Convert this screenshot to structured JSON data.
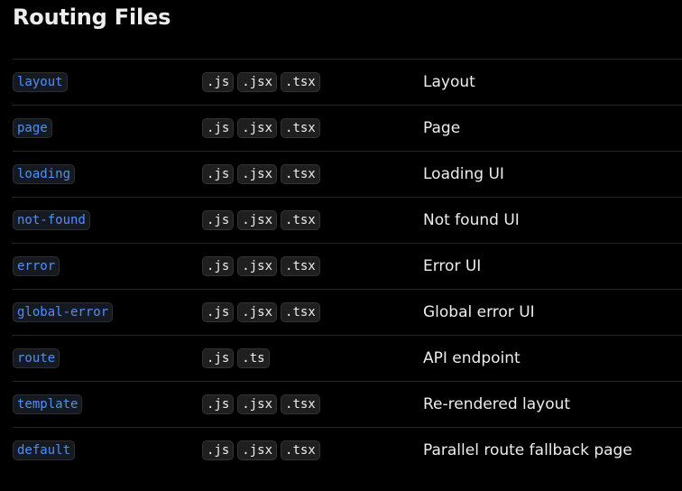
{
  "page": {
    "title": "Routing Files"
  },
  "rows": [
    {
      "file": "layout",
      "exts": [
        ".js",
        ".jsx",
        ".tsx"
      ],
      "desc": "Layout"
    },
    {
      "file": "page",
      "exts": [
        ".js",
        ".jsx",
        ".tsx"
      ],
      "desc": "Page"
    },
    {
      "file": "loading",
      "exts": [
        ".js",
        ".jsx",
        ".tsx"
      ],
      "desc": "Loading UI"
    },
    {
      "file": "not-found",
      "exts": [
        ".js",
        ".jsx",
        ".tsx"
      ],
      "desc": "Not found UI"
    },
    {
      "file": "error",
      "exts": [
        ".js",
        ".jsx",
        ".tsx"
      ],
      "desc": "Error UI"
    },
    {
      "file": "global-error",
      "exts": [
        ".js",
        ".jsx",
        ".tsx"
      ],
      "desc": "Global error UI"
    },
    {
      "file": "route",
      "exts": [
        ".js",
        ".ts"
      ],
      "desc": "API endpoint"
    },
    {
      "file": "template",
      "exts": [
        ".js",
        ".jsx",
        ".tsx"
      ],
      "desc": "Re-rendered layout"
    },
    {
      "file": "default",
      "exts": [
        ".js",
        ".jsx",
        ".tsx"
      ],
      "desc": "Parallel route fallback page"
    }
  ]
}
